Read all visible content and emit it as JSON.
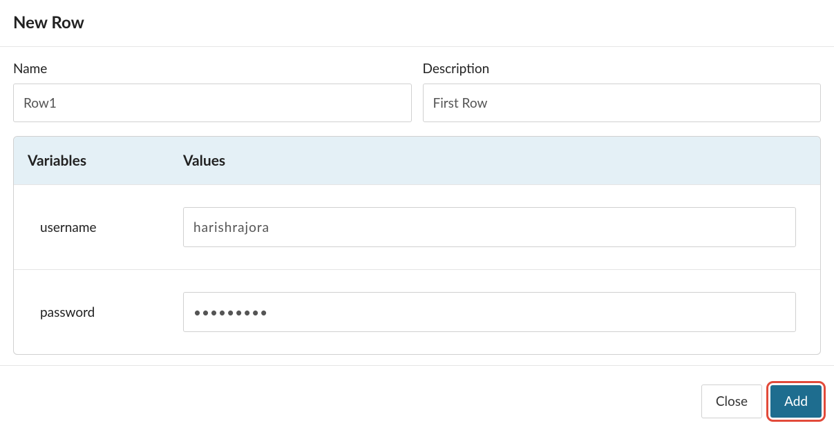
{
  "header": {
    "title": "New Row"
  },
  "fields": {
    "name": {
      "label": "Name",
      "value": "Row1"
    },
    "description": {
      "label": "Description",
      "value": "First Row"
    }
  },
  "table": {
    "headers": {
      "variables": "Variables",
      "values": "Values"
    },
    "rows": [
      {
        "variable": "username",
        "value": "harishrajora",
        "type": "text"
      },
      {
        "variable": "password",
        "value": "•••••••••",
        "type": "text"
      }
    ]
  },
  "footer": {
    "close": "Close",
    "add": "Add"
  }
}
